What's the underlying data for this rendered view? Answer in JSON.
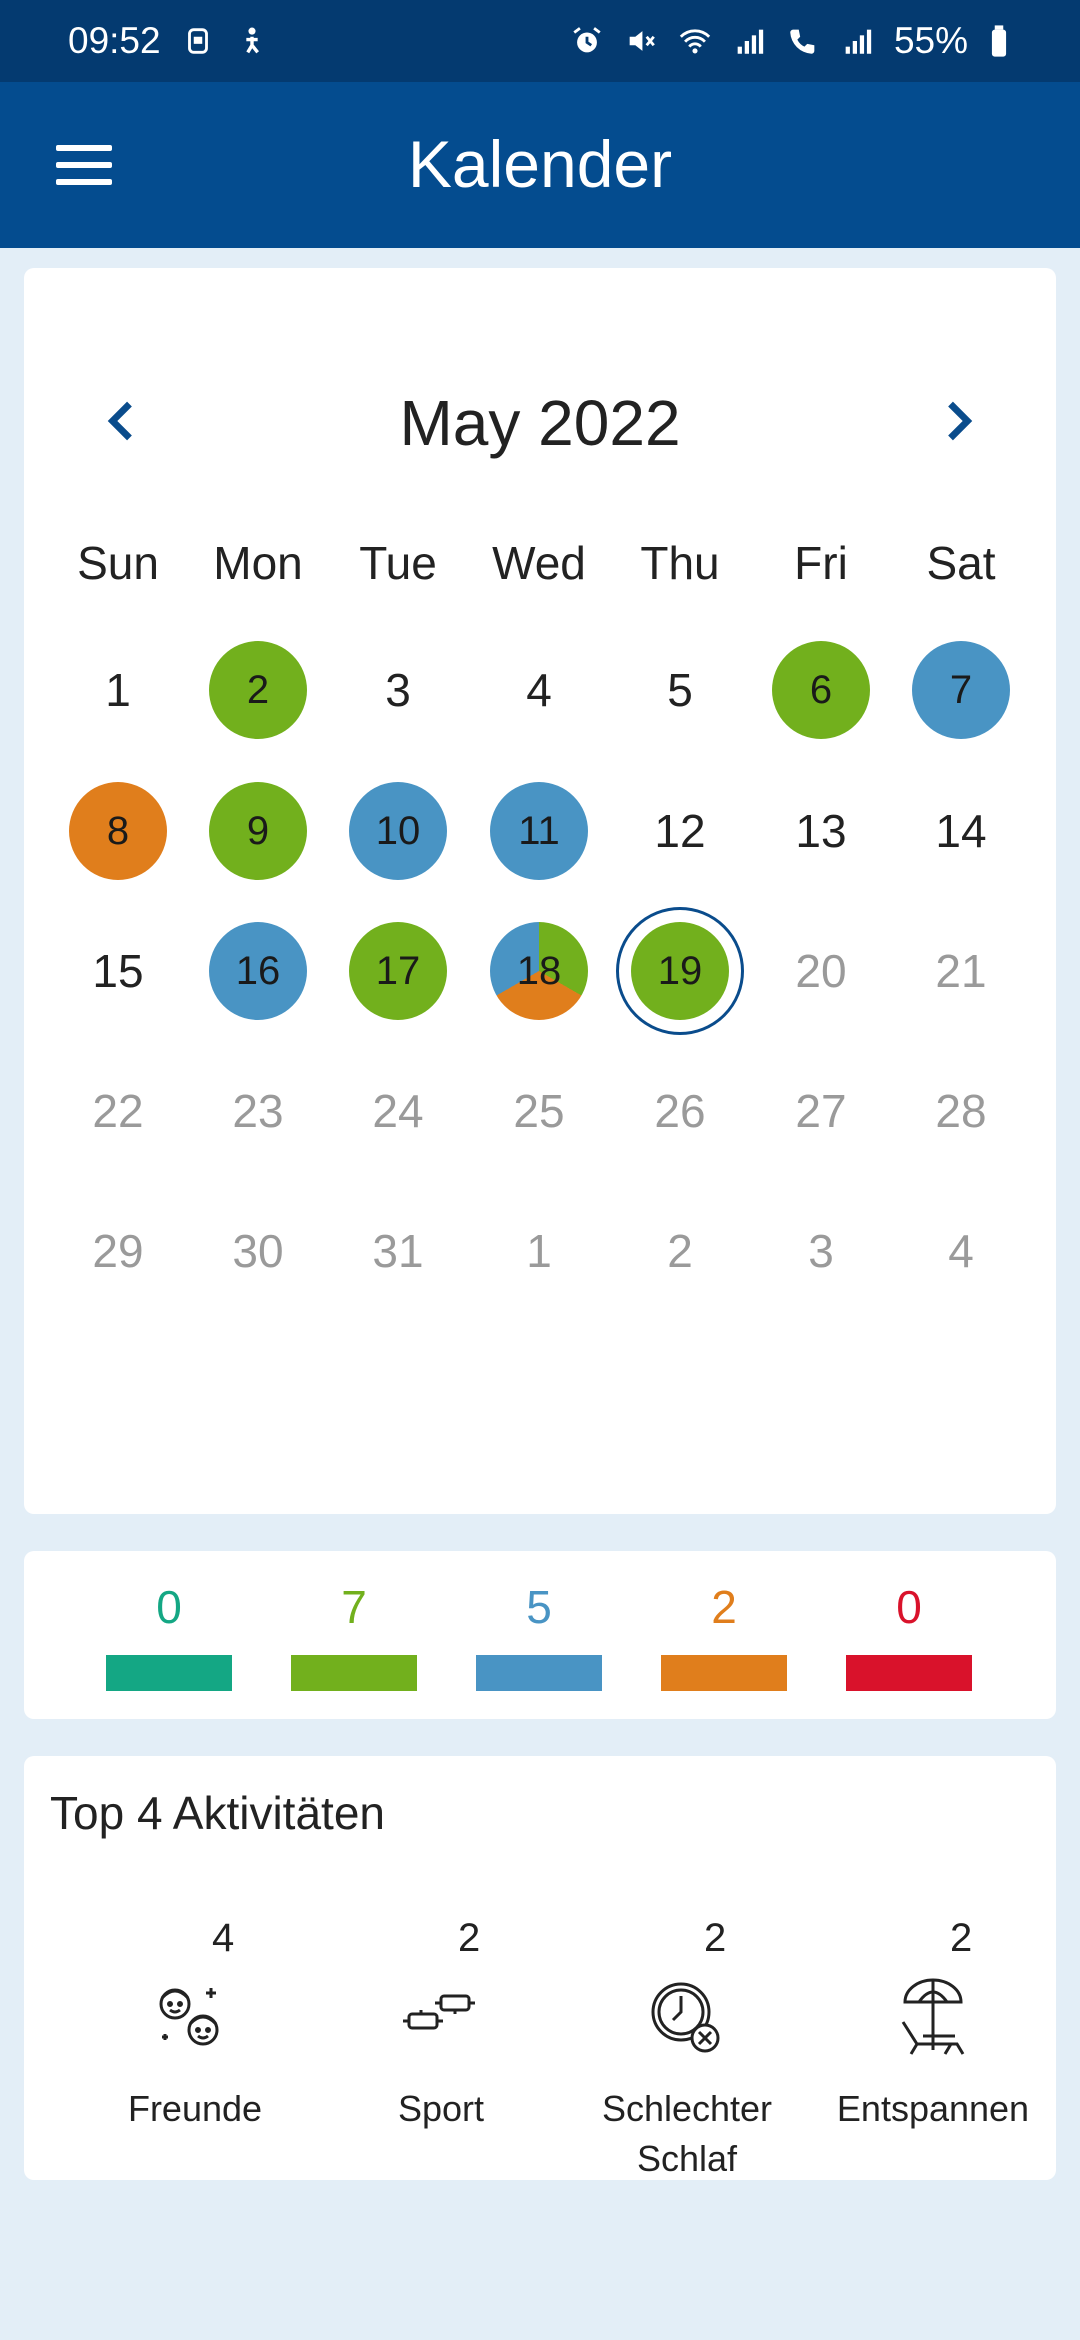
{
  "status_bar": {
    "time": "09:52",
    "battery": "55%",
    "left_icons": [
      "sim-card-icon",
      "accessibility-icon"
    ],
    "right_icons": [
      "alarm-icon",
      "mute-icon",
      "wifi-icon",
      "signal-icon",
      "volte-call-icon",
      "signal-icon",
      "battery-icon"
    ]
  },
  "app_bar": {
    "title": "Kalender",
    "menu_icon": "hamburger-menu-icon"
  },
  "calendar": {
    "month_title": "May 2022",
    "prev_icon": "chevron-left-icon",
    "next_icon": "chevron-right-icon",
    "weekdays": [
      "Sun",
      "Mon",
      "Tue",
      "Wed",
      "Thu",
      "Fri",
      "Sat"
    ],
    "days": [
      {
        "label": "1",
        "state": "plain"
      },
      {
        "label": "2",
        "state": "marked",
        "mood": "green"
      },
      {
        "label": "3",
        "state": "plain"
      },
      {
        "label": "4",
        "state": "plain"
      },
      {
        "label": "5",
        "state": "plain"
      },
      {
        "label": "6",
        "state": "marked",
        "mood": "green"
      },
      {
        "label": "7",
        "state": "marked",
        "mood": "blue"
      },
      {
        "label": "8",
        "state": "marked",
        "mood": "orange"
      },
      {
        "label": "9",
        "state": "marked",
        "mood": "green"
      },
      {
        "label": "10",
        "state": "marked",
        "mood": "blue"
      },
      {
        "label": "11",
        "state": "marked",
        "mood": "blue"
      },
      {
        "label": "12",
        "state": "plain"
      },
      {
        "label": "13",
        "state": "plain"
      },
      {
        "label": "14",
        "state": "plain"
      },
      {
        "label": "15",
        "state": "plain"
      },
      {
        "label": "16",
        "state": "marked",
        "mood": "blue"
      },
      {
        "label": "17",
        "state": "marked",
        "mood": "green"
      },
      {
        "label": "18",
        "state": "marked",
        "mood": "mixed",
        "moods": [
          "green",
          "orange",
          "blue"
        ]
      },
      {
        "label": "19",
        "state": "marked",
        "mood": "green",
        "today": true
      },
      {
        "label": "20",
        "state": "future"
      },
      {
        "label": "21",
        "state": "future"
      },
      {
        "label": "22",
        "state": "future"
      },
      {
        "label": "23",
        "state": "future"
      },
      {
        "label": "24",
        "state": "future"
      },
      {
        "label": "25",
        "state": "future"
      },
      {
        "label": "26",
        "state": "future"
      },
      {
        "label": "27",
        "state": "future"
      },
      {
        "label": "28",
        "state": "future"
      },
      {
        "label": "29",
        "state": "future"
      },
      {
        "label": "30",
        "state": "future"
      },
      {
        "label": "31",
        "state": "future"
      },
      {
        "label": "1",
        "state": "future"
      },
      {
        "label": "2",
        "state": "future"
      },
      {
        "label": "3",
        "state": "future"
      },
      {
        "label": "4",
        "state": "future"
      }
    ]
  },
  "mood_colors": {
    "teal": "#14a784",
    "green": "#72b01d",
    "blue": "#4994c4",
    "orange": "#e07e1c",
    "red": "#d9122b",
    "today_ring": "#0a4c8c"
  },
  "legend": [
    {
      "count": "0",
      "color": "#14a784"
    },
    {
      "count": "7",
      "color": "#72b01d"
    },
    {
      "count": "5",
      "color": "#4994c4"
    },
    {
      "count": "2",
      "color": "#e07e1c"
    },
    {
      "count": "0",
      "color": "#d9122b"
    }
  ],
  "top_activities": {
    "title": "Top 4 Aktivitäten",
    "items": [
      {
        "label": "Freunde",
        "count": "4",
        "icon": "friends-icon"
      },
      {
        "label": "Sport",
        "count": "2",
        "icon": "dumbbell-icon"
      },
      {
        "label": "Schlechter Schlaf",
        "count": "2",
        "icon": "bad-sleep-icon"
      },
      {
        "label": "Entspannen",
        "count": "2",
        "icon": "beach-chair-icon"
      }
    ]
  }
}
